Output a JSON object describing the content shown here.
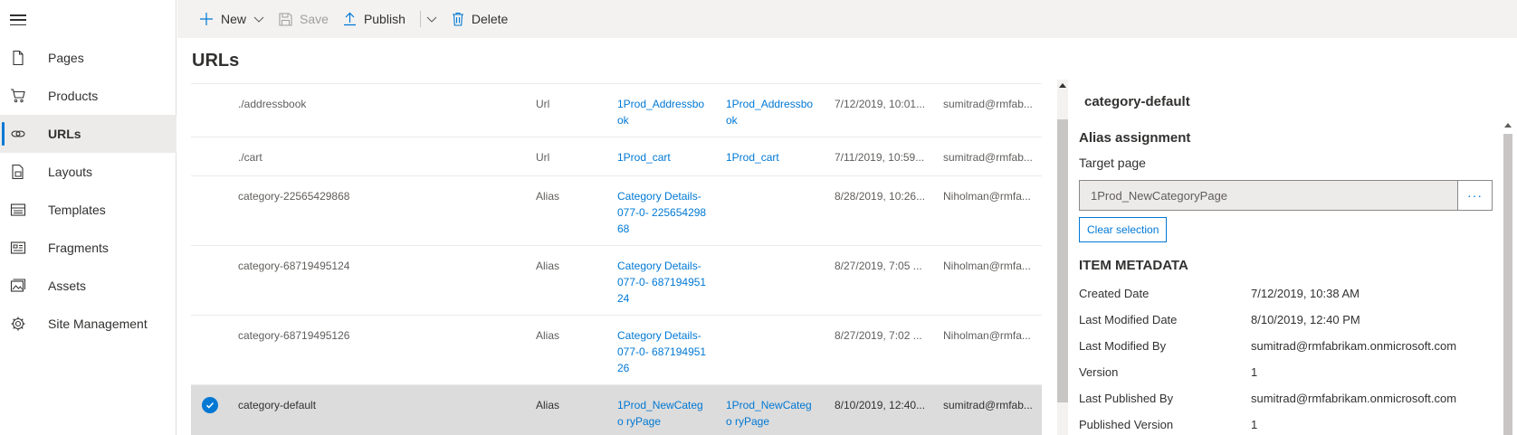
{
  "sidebar": {
    "items": [
      {
        "label": "Pages",
        "icon": "page-icon"
      },
      {
        "label": "Products",
        "icon": "cart-icon"
      },
      {
        "label": "URLs",
        "icon": "link-icon",
        "active": true
      },
      {
        "label": "Layouts",
        "icon": "layout-icon"
      },
      {
        "label": "Templates",
        "icon": "template-icon"
      },
      {
        "label": "Fragments",
        "icon": "fragment-icon"
      },
      {
        "label": "Assets",
        "icon": "image-icon"
      },
      {
        "label": "Site Management",
        "icon": "gear-icon"
      }
    ]
  },
  "toolbar": {
    "new_label": "New",
    "save_label": "Save",
    "publish_label": "Publish",
    "delete_label": "Delete"
  },
  "page": {
    "title": "URLs"
  },
  "rows": [
    {
      "name": "./addressbook",
      "type": "Url",
      "target": "1Prod_Addressbo ok",
      "target2": "1Prod_Addressbo ok",
      "date": "7/12/2019, 10:01...",
      "by": "sumitrad@rmfab..."
    },
    {
      "name": "./cart",
      "type": "Url",
      "target": "1Prod_cart",
      "target2": "1Prod_cart",
      "date": "7/11/2019, 10:59...",
      "by": "sumitrad@rmfab..."
    },
    {
      "name": "category-22565429868",
      "type": "Alias",
      "target": "Category Details- 077-0- 22565429868",
      "target2": "",
      "date": "8/28/2019, 10:26...",
      "by": "Niholman@rmfa..."
    },
    {
      "name": "category-68719495124",
      "type": "Alias",
      "target": "Category Details- 077-0- 68719495124",
      "target2": "",
      "date": "8/27/2019, 7:05 ...",
      "by": "Niholman@rmfa..."
    },
    {
      "name": "category-68719495126",
      "type": "Alias",
      "target": "Category Details- 077-0- 68719495126",
      "target2": "",
      "date": "8/27/2019, 7:02 ...",
      "by": "Niholman@rmfa..."
    },
    {
      "name": "category-default",
      "type": "Alias",
      "target": "1Prod_NewCatego ryPage",
      "target2": "1Prod_NewCatego ryPage",
      "date": "8/10/2019, 12:40...",
      "by": "sumitrad@rmfab...",
      "selected": true
    }
  ],
  "details": {
    "title": "category-default",
    "section_alias": "Alias assignment",
    "target_page_label": "Target page",
    "target_page_value": "1Prod_NewCategoryPage",
    "browse_label": "···",
    "clear_label": "Clear selection",
    "section_meta": "ITEM METADATA",
    "metadata": [
      {
        "key": "Created Date",
        "value": "7/12/2019, 10:38 AM"
      },
      {
        "key": "Last Modified Date",
        "value": "8/10/2019, 12:40 PM"
      },
      {
        "key": "Last Modified By",
        "value": "sumitrad@rmfabrikam.onmicrosoft.com"
      },
      {
        "key": "Version",
        "value": "1"
      },
      {
        "key": "Last Published By",
        "value": "sumitrad@rmfabrikam.onmicrosoft.com"
      },
      {
        "key": "Published Version",
        "value": "1"
      }
    ]
  },
  "colors": {
    "accent": "#0078d4",
    "selected_row": "#dcdcdc",
    "command_bar": "#f3f2f1"
  }
}
